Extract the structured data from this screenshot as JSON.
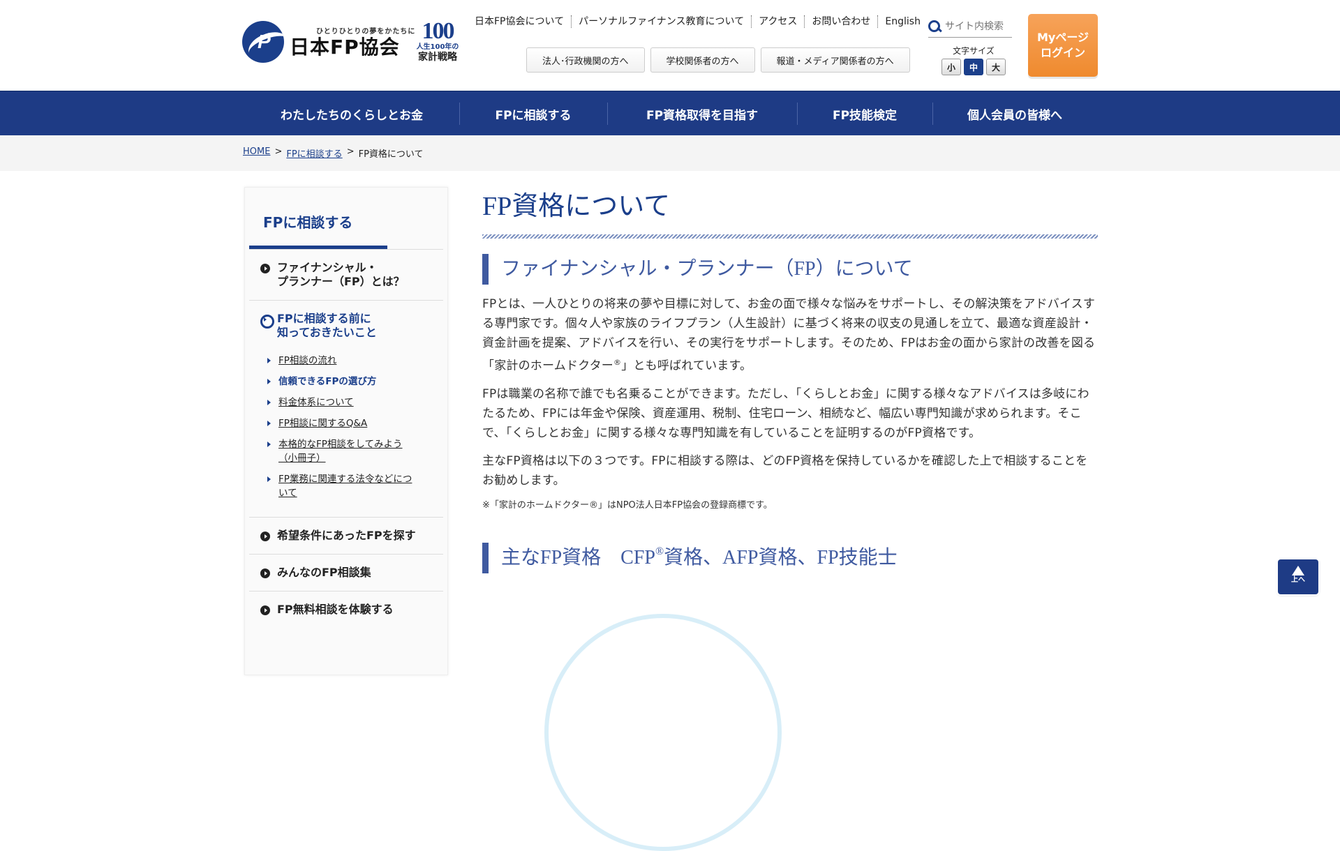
{
  "header": {
    "logo_tagline": "ひとりひとりの夢をかたちに",
    "logo_name": "日本FP協会",
    "logo100_number": "100",
    "logo100_line1": "人生100年の",
    "logo100_line2": "家計戦略",
    "util_nav": [
      "日本FP協会について",
      "パーソナルファイナンス教育について",
      "アクセス",
      "お問い合わせ",
      "English"
    ],
    "audience_buttons": [
      "法人･行政機関の方へ",
      "学校関係者の方へ",
      "報道・メディア関係者の方へ"
    ],
    "search_placeholder": "サイト内検索",
    "font_size_label": "文字サイズ",
    "font_size_options": [
      "小",
      "中",
      "大"
    ],
    "mypage_label": "Myページ\nログイン"
  },
  "global_nav": [
    "わたしたちのくらしとお金",
    "FPに相談する",
    "FP資格取得を目指す",
    "FP技能検定",
    "個人会員の皆様へ"
  ],
  "breadcrumb": {
    "home": "HOME",
    "parent": "FPに相談する",
    "sep": ">",
    "current": "FP資格について"
  },
  "sidebar": {
    "title": "FPに相談する",
    "item1": "ファイナンシャル・\nプランナー（FP）とは？",
    "item2": "FPに相談する前に\n知っておきたいこと",
    "sub": [
      "FP相談の流れ",
      "信頼できるFPの選び方",
      "料金体系について",
      "FP相談に関するQ&A",
      "本格的なFP相談をしてみよう\n（小冊子）",
      "FP業務に関連する法令などにつ\nいて"
    ],
    "item3": "希望条件にあったFPを探す",
    "item4": "みんなのFP相談集",
    "item5": "FP無料相談を体験する"
  },
  "main": {
    "page_title": "FP資格について",
    "section1_heading": "ファイナンシャル・プランナー（FP）について",
    "p1_a": "FPとは、一人ひとりの将来の夢や目標に対して、お金の面で様々な悩みをサポートし、その解決策をアドバイスする専門家です。個々人や家族のライフプラン（人生設計）に基づく将来の収支の見通しを立て、最適な資産設計・資金計画を提案、アドバイスを行い、その実行をサポートします。そのため、FPはお金の面から家計の改善を図る「家計のホームドクター",
    "p1_sup": "®",
    "p1_b": "」とも呼ばれています。",
    "p2": "FPは職業の名称で誰でも名乗ることができます。ただし、「くらしとお金」に関する様々なアドバイスは多岐にわたるため、FPには年金や保険、資産運用、税制、住宅ローン、相続など、幅広い専門知識が求められます。そこで、「くらしとお金」に関する様々な専門知識を有していることを証明するのがFP資格です。",
    "p3": "主なFP資格は以下の３つです。FPに相談する際は、どのFP資格を保持しているかを確認した上で相談することをお勧めします。",
    "note": "※「家計のホームドクター®」はNPO法人日本FP協会の登録商標です。",
    "section2_heading_a": "主なFP資格　CFP",
    "section2_heading_sup": "®",
    "section2_heading_b": "資格、AFP資格、FP技能士"
  },
  "pagetop_label": "上へ"
}
